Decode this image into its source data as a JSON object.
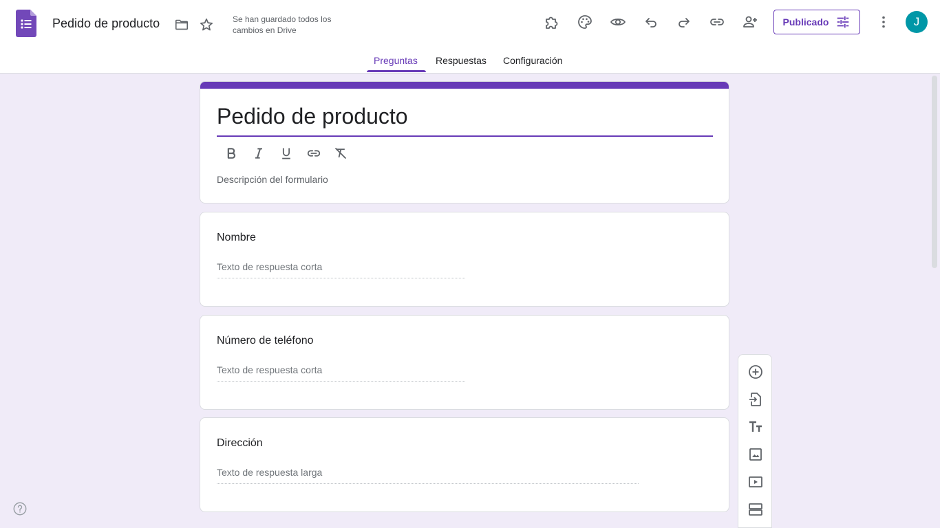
{
  "header": {
    "doc_title": "Pedido de producto",
    "save_status": "Se han guardado todos los cambios en Drive",
    "publish_label": "Publicado",
    "avatar_initial": "J"
  },
  "icons": {
    "app_logo": "google-forms-logo-icon",
    "folder": "folder-icon",
    "star": "star-icon",
    "addons": "puzzle-icon",
    "theme": "palette-icon",
    "preview": "eye-icon",
    "undo": "undo-icon",
    "redo": "redo-icon",
    "link": "link-icon",
    "collaborators": "person-add-icon",
    "publish_settings": "tune-icon",
    "more": "more-vert-icon",
    "help": "help-icon"
  },
  "tabs": [
    {
      "label": "Preguntas",
      "active": true
    },
    {
      "label": "Respuestas",
      "active": false
    },
    {
      "label": "Configuración",
      "active": false
    }
  ],
  "form": {
    "title": "Pedido de producto",
    "description_placeholder": "Descripción del formulario",
    "format_tools": [
      "bold",
      "italic",
      "underline",
      "link",
      "clear-formatting"
    ]
  },
  "questions": [
    {
      "title": "Nombre",
      "hint": "Texto de respuesta corta"
    },
    {
      "title": "Número de teléfono",
      "hint": "Texto de respuesta corta"
    },
    {
      "title": "Dirección",
      "hint": "Texto de respuesta larga"
    }
  ],
  "side_toolbar": [
    "add-question",
    "import-questions",
    "add-title-description",
    "add-image",
    "add-video",
    "add-section"
  ],
  "colors": {
    "accent": "#673ab7",
    "background": "#f0ebf8",
    "avatar": "#0097a7"
  }
}
